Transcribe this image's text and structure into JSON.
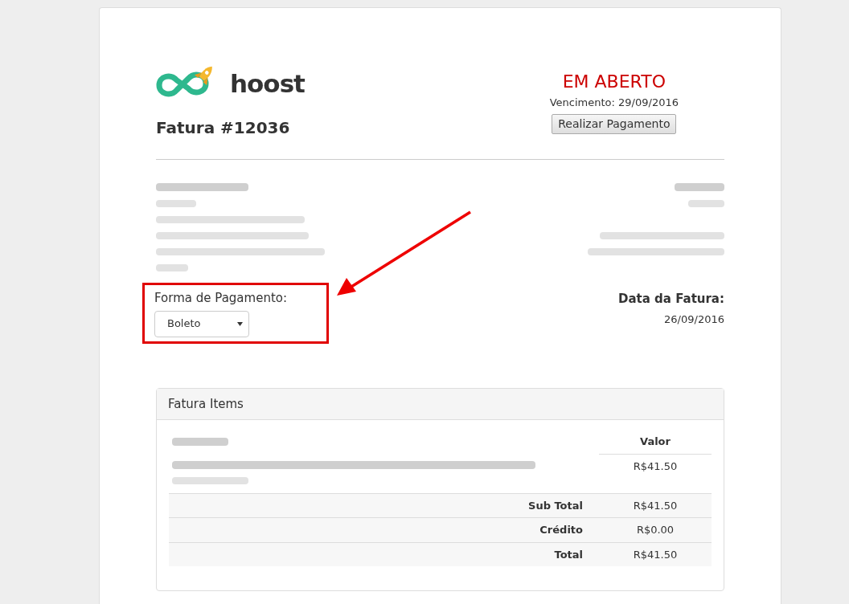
{
  "logo": {
    "text": "hoost"
  },
  "invoice_title": "Fatura #12036",
  "status": {
    "label": "EM ABERTO",
    "due": "Vencimento: 29/09/2016",
    "pay_button": "Realizar Pagamento"
  },
  "payment_method": {
    "label": "Forma de Pagamento:",
    "value": "Boleto",
    "highlighted": true
  },
  "invoice_date": {
    "label": "Data da Fatura:",
    "value": "26/09/2016"
  },
  "items_panel": {
    "title": "Fatura Items",
    "value_column": "Valor",
    "rows": [
      {
        "value": "R$41.50"
      }
    ],
    "totals": [
      {
        "label": "Sub Total",
        "value": "R$41.50"
      },
      {
        "label": "Crédito",
        "value": "R$0.00"
      },
      {
        "label": "Total",
        "value": "R$41.50"
      }
    ]
  },
  "annotation": {
    "arrow": true
  }
}
